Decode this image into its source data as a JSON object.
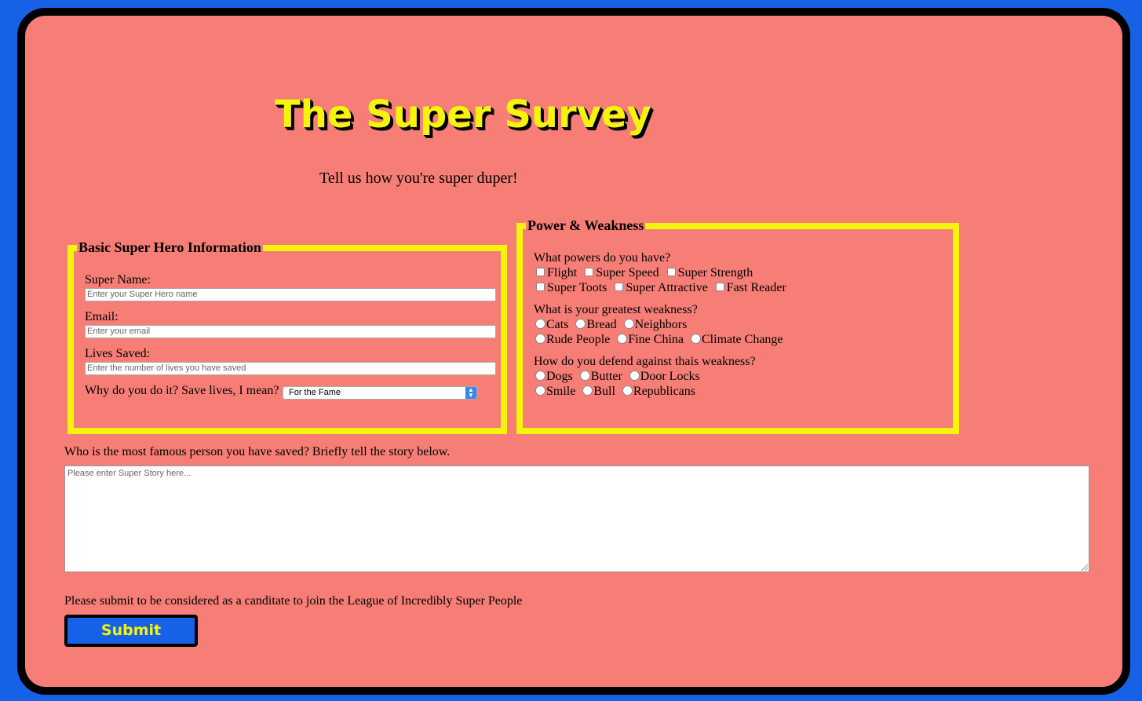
{
  "header": {
    "title": "The Super Survey",
    "subtitle": "Tell us how you're super duper!"
  },
  "basic_info": {
    "legend": "Basic Super Hero Information",
    "super_name_label": "Super Name:",
    "super_name_placeholder": "Enter your Super Hero name",
    "email_label": "Email:",
    "email_placeholder": "Enter your email",
    "lives_label": "Lives Saved:",
    "lives_placeholder": "Enter the number of lives you have saved",
    "why_label": "Why do you do it? Save lives, I mean?",
    "why_selected": "For the Fame"
  },
  "power_weakness": {
    "legend": "Power & Weakness",
    "powers_question": "What powers do you have?",
    "powers": [
      "Flight",
      "Super Speed",
      "Super Strength",
      "Super Toots",
      "Super Attractive",
      "Fast Reader"
    ],
    "weakness_question": "What is your greatest weakness?",
    "weaknesses": [
      "Cats",
      "Bread",
      "Neighbors",
      "Rude People",
      "Fine China",
      "Climate Change"
    ],
    "defense_question": "How do you defend against thais weakness?",
    "defenses": [
      "Dogs",
      "Butter",
      "Door Locks",
      "Smile",
      "Bull",
      "Republicans"
    ]
  },
  "story": {
    "prompt": "Who is the most famous person you have saved? Briefly tell the story below.",
    "placeholder": "Please enter Super Story here..."
  },
  "submit": {
    "note": "Please submit to be considered as a canditate to join the League of Incredibly Super People",
    "label": "Submit"
  },
  "colors": {
    "page_background": "#1761e7",
    "card_background": "#f67e76",
    "accent_yellow": "#f6f40d",
    "border_black": "#000000"
  }
}
